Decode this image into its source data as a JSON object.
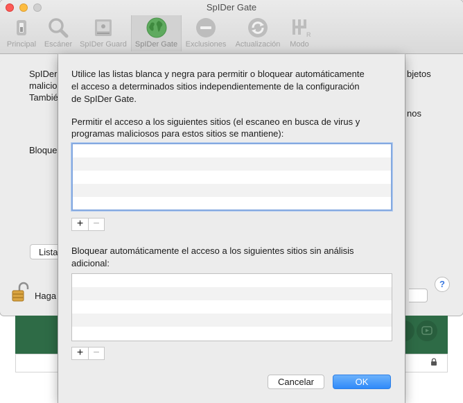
{
  "window": {
    "title": "SpIDer Gate"
  },
  "toolbar": {
    "items": [
      {
        "label": "Principal",
        "icon": "switch-icon"
      },
      {
        "label": "Escáner",
        "icon": "magnifier-icon"
      },
      {
        "label": "SpIDer Guard",
        "icon": "drive-icon"
      },
      {
        "label": "SpIDer Gate",
        "icon": "globe-icon",
        "selected": true
      },
      {
        "label": "Exclusiones",
        "icon": "minus-circle-icon"
      },
      {
        "label": "Actualización",
        "icon": "refresh-icon"
      },
      {
        "label": "Modo",
        "icon": "gearshift-icon"
      }
    ]
  },
  "background": {
    "line1_left": "SpIDer",
    "line1_right": "bjetos",
    "line2_left": "malicio",
    "line3_left": "Tambié",
    "line3_right": "nos",
    "bloquear": "Bloque",
    "lista_button": "Lista",
    "haga": "Haga"
  },
  "sheet": {
    "intro_line1": "Utilice las listas blanca y negra para permitir o bloquear automáticamente",
    "intro_line2": "el acceso a determinados sitios independientemente de la configuración",
    "intro_line3": "de SpIDer Gate.",
    "allow_line1": "Permitir el acceso a los siguientes sitios (el escaneo en busca de virus y",
    "allow_line2": "programas maliciosos para estos sitios se mantiene):",
    "block_line1": "Bloquear automáticamente el acceso a los siguientes sitios sin análisis",
    "block_line2": "adicional:",
    "add_symbol": "+",
    "remove_symbol": "−",
    "cancel_label": "Cancelar",
    "ok_label": "OK"
  },
  "help": {
    "symbol": "?"
  },
  "colors": {
    "accent": "#2f8af9",
    "globe_green": "#5faa5f",
    "focus_ring": "#84a9e0",
    "panel_green": "#2e6b46"
  }
}
